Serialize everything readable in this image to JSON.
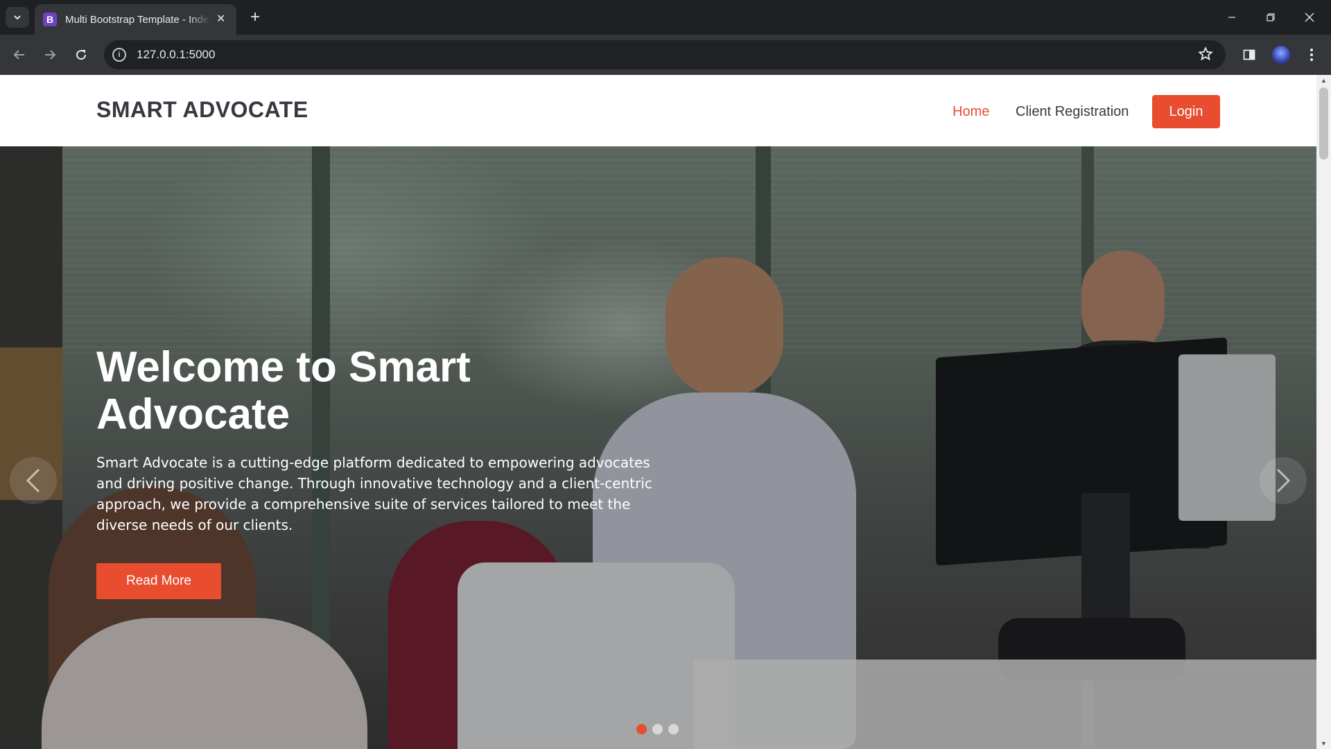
{
  "browser": {
    "tab_title": "Multi Bootstrap Template - Index",
    "tab_favicon_letter": "B",
    "url": "127.0.0.1:5000",
    "icons": [
      "tab-search-icon",
      "close-icon",
      "new-tab-icon",
      "minimize-icon",
      "restore-icon",
      "window-close-icon",
      "back-icon",
      "forward-icon",
      "reload-icon",
      "site-info-icon",
      "bookmark-star-icon",
      "side-panel-icon",
      "avatar",
      "menu-kebab-icon"
    ]
  },
  "site": {
    "logo": "SMART ADVOCATE",
    "nav": [
      {
        "label": "Home",
        "active": true
      },
      {
        "label": "Client Registration",
        "active": false
      }
    ],
    "login_label": "Login",
    "accent_color": "#e84d2f"
  },
  "hero": {
    "title": "Welcome to Smart Advocate",
    "text": "Smart Advocate is a cutting-edge platform dedicated to empowering advocates and driving positive change. Through innovative technology and a client-centric approach, we provide a comprehensive suite of services tailored to meet the diverse needs of our clients.",
    "button_label": "Read More",
    "slides": 3,
    "active_slide": 1
  }
}
